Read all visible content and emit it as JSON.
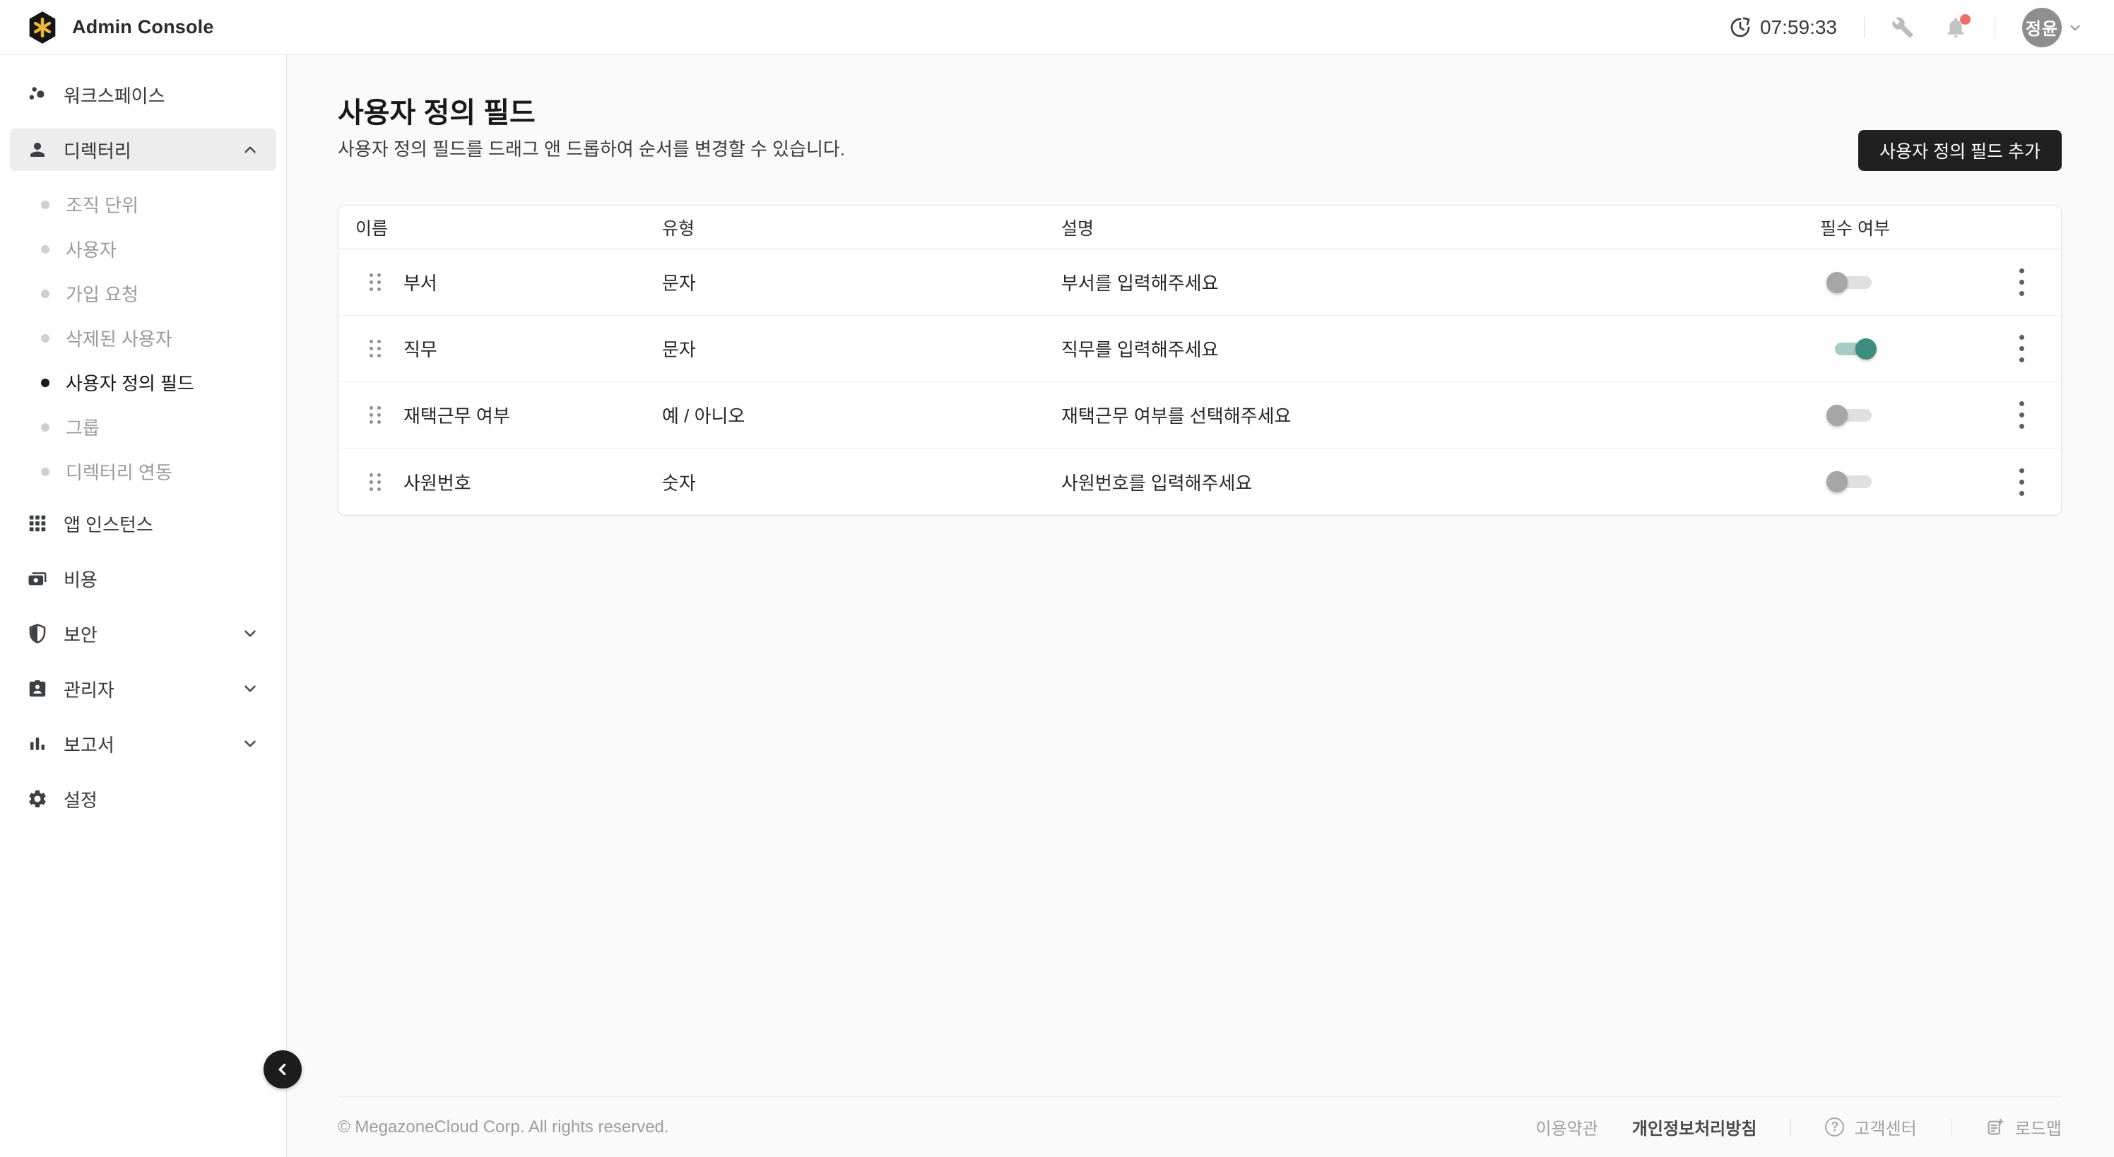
{
  "topbar": {
    "app_title": "Admin Console",
    "time": "07:59:33",
    "user_initials": "정윤"
  },
  "sidebar": {
    "workspace": "워크스페이스",
    "directory": "디렉터리",
    "directory_children": [
      "조직 단위",
      "사용자",
      "가입 요청",
      "삭제된 사용자",
      "사용자 정의 필드",
      "그룹",
      "디렉터리 연동"
    ],
    "active_child": "사용자 정의 필드",
    "app_instance": "앱 인스턴스",
    "cost": "비용",
    "security": "보안",
    "admin": "관리자",
    "reports": "보고서",
    "settings": "설정"
  },
  "page": {
    "title": "사용자 정의 필드",
    "subtitle": "사용자 정의 필드를 드래그 앤 드롭하여 순서를 변경할 수 있습니다.",
    "add_button": "사용자 정의 필드 추가"
  },
  "table": {
    "columns": [
      "이름",
      "유형",
      "설명",
      "필수 여부"
    ],
    "rows": [
      {
        "name": "부서",
        "type": "문자",
        "description": "부서를 입력해주세요",
        "required": false
      },
      {
        "name": "직무",
        "type": "문자",
        "description": "직무를 입력해주세요",
        "required": true
      },
      {
        "name": "재택근무 여부",
        "type": "예 / 아니오",
        "description": "재택근무 여부를 선택해주세요",
        "required": false
      },
      {
        "name": "사원번호",
        "type": "숫자",
        "description": "사원번호를 입력해주세요",
        "required": false
      }
    ]
  },
  "footer": {
    "copyright": "© MegazoneCloud Corp. All rights reserved.",
    "terms": "이용약관",
    "privacy": "개인정보처리방침",
    "help_center": "고객센터",
    "roadmap": "로드맵",
    "help_glyph": "?"
  },
  "colors": {
    "accent_teal": "#3d8e7e",
    "button_dark": "#202020",
    "notification_red": "#ee6f6a",
    "logo_gold": "#efb832",
    "main_bg": "#fafafa"
  }
}
